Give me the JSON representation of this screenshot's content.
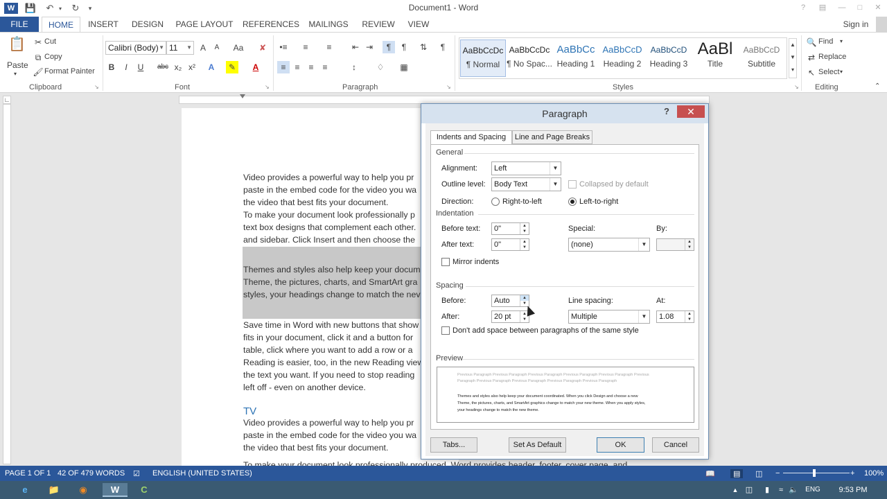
{
  "app": {
    "title": "Document1 - Word",
    "sign_in": "Sign in",
    "help": "?"
  },
  "tabs": [
    "FILE",
    "HOME",
    "INSERT",
    "DESIGN",
    "PAGE LAYOUT",
    "REFERENCES",
    "MAILINGS",
    "REVIEW",
    "VIEW"
  ],
  "ribbon": {
    "clipboard": {
      "label": "Clipboard",
      "paste": "Paste",
      "cut": "Cut",
      "copy": "Copy",
      "format_painter": "Format Painter"
    },
    "font": {
      "label": "Font",
      "font_name": "Calibri (Body)",
      "font_size": "11",
      "grow": "A",
      "shrink": "A",
      "case": "Aa",
      "bold": "B",
      "italic": "I",
      "underline": "U",
      "strike": "abc",
      "subscript": "x₂",
      "superscript": "x²",
      "font_color": "A"
    },
    "paragraph": {
      "label": "Paragraph"
    },
    "styles": {
      "label": "Styles",
      "items": [
        {
          "sample": "AaBbCcDc",
          "name": "¶ Normal"
        },
        {
          "sample": "AaBbCcDc",
          "name": "¶ No Spac..."
        },
        {
          "sample": "AaBbCc",
          "name": "Heading 1"
        },
        {
          "sample": "AaBbCcD",
          "name": "Heading 2"
        },
        {
          "sample": "AaBbCcD",
          "name": "Heading 3"
        },
        {
          "sample": "AaBl",
          "name": "Title"
        },
        {
          "sample": "AaBbCcD",
          "name": "Subtitle"
        }
      ]
    },
    "editing": {
      "label": "Editing",
      "find": "Find",
      "replace": "Replace",
      "select": "Select"
    }
  },
  "document": {
    "lines": [
      "Video provides a powerful way to help you pr",
      "paste in the embed code for the video you wa",
      "the video that best fits your document.",
      "To make your document look professionally p",
      "text box designs that complement each other.",
      "and sidebar. Click Insert and then choose the",
      "Themes and styles also help keep your docum",
      "Theme, the pictures, charts, and SmartArt gra",
      "styles, your headings change to match the nev",
      "Save time in Word with new buttons that show",
      "fits in your document, click it and a button for",
      "table, click where you want to add a row or a",
      "Reading is easier, too, in the new Reading view",
      "the text you want. If you need to stop reading",
      "left off - even on another device.",
      "Video provides a powerful way to help you pr",
      "paste in the embed code for the video you wa",
      "the video that best fits your document.",
      "To make your document look professionally produced, Word provides header, footer, cover page, and"
    ],
    "heading": "TV"
  },
  "status": {
    "page": "PAGE 1 OF 1",
    "words": "42 OF 479 WORDS",
    "language": "ENGLISH (UNITED STATES)",
    "zoom": "100%",
    "zoom_minus": "−",
    "zoom_plus": "+"
  },
  "taskbar": {
    "lang": "ENG",
    "time": "9:53 PM"
  },
  "dialog": {
    "title": "Paragraph",
    "help": "?",
    "close": "✕",
    "tabs": [
      "Indents and Spacing",
      "Line and Page Breaks"
    ],
    "general": {
      "heading": "General",
      "alignment_label": "Alignment:",
      "alignment_value": "Left",
      "outline_label": "Outline level:",
      "outline_value": "Body Text",
      "collapsed_label": "Collapsed by default",
      "direction_label": "Direction:",
      "rtl_label": "Right-to-left",
      "ltr_label": "Left-to-right"
    },
    "indentation": {
      "heading": "Indentation",
      "before_label": "Before text:",
      "before_value": "0\"",
      "after_label": "After text:",
      "after_value": "0\"",
      "special_label": "Special:",
      "special_value": "(none)",
      "by_label": "By:",
      "by_value": "",
      "mirror_label": "Mirror indents"
    },
    "spacing": {
      "heading": "Spacing",
      "before_label": "Before:",
      "before_value": "Auto",
      "after_label": "After:",
      "after_value": "20 pt",
      "line_spacing_label": "Line spacing:",
      "line_spacing_value": "Multiple",
      "at_label": "At:",
      "at_value": "1.08",
      "dont_add_label": "Don't add space between paragraphs of the same style"
    },
    "preview": {
      "heading": "Preview",
      "prev_lines": [
        "Previous Paragraph Previous Paragraph Previous Paragraph Previous Paragraph Previous Paragraph Previous",
        "Paragraph Previous Paragraph Previous Paragraph Previous Paragraph Previous Paragraph"
      ],
      "sample_lines": [
        "Themes and styles also help keep your document coordinated. When you click Design and choose a new",
        "Theme, the pictures, charts, and SmartArt graphics change to match your new theme. When you apply styles,",
        "your headings change to match the new theme."
      ]
    },
    "buttons": {
      "tabs": "Tabs...",
      "set_default": "Set As Default",
      "ok": "OK",
      "cancel": "Cancel"
    }
  },
  "colors": {
    "word_blue": "#2b579a",
    "heading_blue": "#2e74b5",
    "close_red": "#c75050"
  }
}
